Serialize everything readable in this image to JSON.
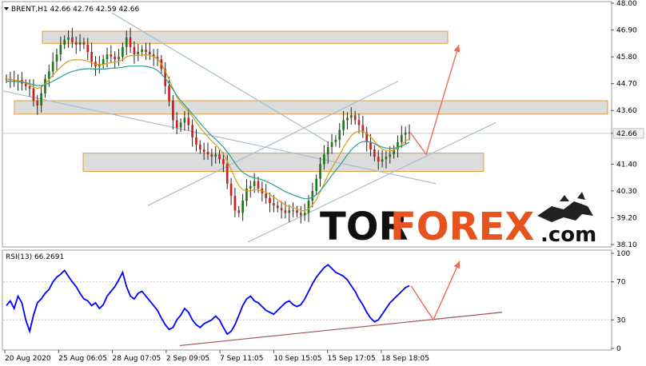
{
  "header": {
    "symbol_line": "BRENT,H1  42.66 42.76 42.59 42.66"
  },
  "rsi_header": "RSI(13) 66.2691",
  "brand": {
    "part1": "TOR",
    "part2": "FOREX",
    "part3": ".com",
    "color_dark": "#111111",
    "color_accent": "#e8521e"
  },
  "chart_data": [
    {
      "type": "line",
      "title": "BRENT,H1",
      "ylim": [
        38.1,
        48.0
      ],
      "y_ticks": [
        "48.00",
        "46.90",
        "45.80",
        "44.70",
        "43.60",
        "42.66",
        "41.40",
        "40.30",
        "39.20",
        "38.10"
      ],
      "x_ticks": [
        "20 Aug 2020",
        "25 Aug 06:05",
        "28 Aug 07:05",
        "2 Sep 09:05",
        "7 Sep 11:05",
        "10 Sep 15:05",
        "15 Sep 17:05",
        "18 Sep 18:05"
      ],
      "current_price": "42.66",
      "series": [
        {
          "kind": "candles",
          "values": [
            44.9,
            44.85,
            44.8,
            44.85,
            44.7,
            44.6,
            44.5,
            44.0,
            43.8,
            44.3,
            44.9,
            45.2,
            45.6,
            45.9,
            46.3,
            46.5,
            46.6,
            46.4,
            46.3,
            46.4,
            46.3,
            46.0,
            45.6,
            45.4,
            45.5,
            45.7,
            45.9,
            45.8,
            45.7,
            45.8,
            46.2,
            46.6,
            46.2,
            45.9,
            46.0,
            46.1,
            46.0,
            45.9,
            45.8,
            45.7,
            45.3,
            44.6,
            44.0,
            43.2,
            42.9,
            43.1,
            43.3,
            43.0,
            42.5,
            42.2,
            42.0,
            41.9,
            41.8,
            41.7,
            41.8,
            41.6,
            41.4,
            40.6,
            40.1,
            39.5,
            39.4,
            39.9,
            40.4,
            40.5,
            40.7,
            40.4,
            40.2,
            40.0,
            39.8,
            39.7,
            39.6,
            39.5,
            39.4,
            39.5,
            39.5,
            39.4,
            39.3,
            39.4,
            39.9,
            40.3,
            40.8,
            41.4,
            41.8,
            42.1,
            42.3,
            42.4,
            42.8,
            43.2,
            43.3,
            43.4,
            43.2,
            43.0,
            42.7,
            42.3,
            42.0,
            41.7,
            41.5,
            41.6,
            41.7,
            41.8,
            42.0,
            42.3,
            42.6,
            42.7,
            42.66
          ]
        },
        {
          "kind": "moving-average-fast",
          "color": "#d4a017",
          "values": [
            44.9,
            44.88,
            44.85,
            44.82,
            44.78,
            44.72,
            44.65,
            44.56,
            44.5,
            44.55,
            44.7,
            44.86,
            45.05,
            45.22,
            45.38,
            45.52,
            45.62,
            45.67,
            45.68,
            45.68,
            45.66,
            45.62,
            45.56,
            45.5,
            45.48,
            45.49,
            45.53,
            45.56,
            45.58,
            45.61,
            45.69,
            45.8,
            45.85,
            45.85,
            45.86,
            45.88,
            45.88,
            45.86,
            45.82,
            45.72,
            45.52,
            45.22,
            44.88,
            44.5,
            44.15,
            43.9,
            43.72,
            43.55,
            43.35,
            43.12,
            42.9,
            42.7,
            42.52,
            42.35,
            42.2,
            42.03,
            41.82,
            41.52,
            41.18,
            40.82,
            40.52,
            40.35,
            40.3,
            40.3,
            40.34,
            40.34,
            40.3,
            40.24,
            40.15,
            40.05,
            39.94,
            39.83,
            39.72,
            39.66,
            39.62,
            39.56,
            39.5,
            39.48,
            39.56,
            39.72,
            39.95,
            40.26,
            40.6,
            40.94,
            41.24,
            41.5,
            41.78,
            42.08,
            42.34,
            42.56,
            42.7,
            42.76,
            42.75,
            42.66,
            42.52,
            42.34,
            42.14,
            42.02,
            41.96,
            41.94,
            41.97,
            42.06,
            42.2,
            42.34,
            42.44
          ]
        },
        {
          "kind": "moving-average-slow",
          "color": "#2a9d8f",
          "values": [
            44.8,
            44.8,
            44.79,
            44.78,
            44.76,
            44.74,
            44.7,
            44.66,
            44.62,
            44.62,
            44.66,
            44.72,
            44.8,
            44.88,
            44.97,
            45.06,
            45.14,
            45.2,
            45.24,
            45.28,
            45.3,
            45.31,
            45.31,
            45.3,
            45.3,
            45.3,
            45.31,
            45.33,
            45.34,
            45.35,
            45.37,
            45.4,
            45.42,
            45.42,
            45.42,
            45.42,
            45.41,
            45.38,
            45.33,
            45.24,
            45.1,
            44.92,
            44.7,
            44.46,
            44.22,
            44.0,
            43.82,
            43.64,
            43.46,
            43.27,
            43.08,
            42.9,
            42.72,
            42.56,
            42.42,
            42.27,
            42.1,
            41.9,
            41.68,
            41.44,
            41.22,
            41.06,
            40.96,
            40.88,
            40.84,
            40.8,
            40.76,
            40.7,
            40.62,
            40.54,
            40.45,
            40.36,
            40.27,
            40.2,
            40.14,
            40.08,
            40.02,
            39.98,
            39.98,
            40.04,
            40.14,
            40.3,
            40.5,
            40.72,
            40.94,
            41.14,
            41.34,
            41.56,
            41.78,
            41.98,
            42.14,
            42.26,
            42.32,
            42.33,
            42.3,
            42.24,
            42.16,
            42.1,
            42.06,
            42.04,
            42.05,
            42.08,
            42.14,
            42.22,
            42.3
          ]
        }
      ],
      "levels": [
        {
          "name": "resistance-upper",
          "low": 46.35,
          "high": 46.85
        },
        {
          "name": "resistance-mid",
          "low": 43.45,
          "high": 44.0
        },
        {
          "name": "support-zone",
          "low": 41.1,
          "high": 41.85
        }
      ],
      "forecast_arrow": {
        "start": 42.66,
        "dip": 41.8,
        "target": 46.3
      }
    },
    {
      "type": "line",
      "title": "RSI(13)",
      "ylim": [
        0,
        100
      ],
      "y_ticks": [
        "100",
        "70",
        "30",
        "0"
      ],
      "series": [
        {
          "name": "RSI(13)",
          "color": "#0000ff",
          "values": [
            45,
            50,
            42,
            55,
            48,
            30,
            18,
            35,
            48,
            52,
            58,
            62,
            70,
            75,
            78,
            82,
            76,
            70,
            65,
            58,
            52,
            50,
            45,
            48,
            42,
            46,
            55,
            60,
            65,
            72,
            80,
            65,
            55,
            52,
            58,
            60,
            55,
            50,
            45,
            40,
            32,
            25,
            20,
            22,
            30,
            35,
            42,
            38,
            30,
            25,
            22,
            26,
            28,
            30,
            34,
            30,
            22,
            15,
            18,
            25,
            35,
            45,
            52,
            55,
            50,
            48,
            44,
            40,
            38,
            36,
            40,
            44,
            48,
            50,
            46,
            44,
            46,
            52,
            60,
            68,
            75,
            80,
            85,
            88,
            84,
            80,
            78,
            76,
            72,
            66,
            60,
            52,
            46,
            38,
            32,
            28,
            30,
            36,
            42,
            48,
            52,
            56,
            60,
            64,
            66
          ]
        }
      ],
      "forecast_arrow": {
        "start": 66,
        "dip": 30,
        "target": 92
      }
    }
  ]
}
